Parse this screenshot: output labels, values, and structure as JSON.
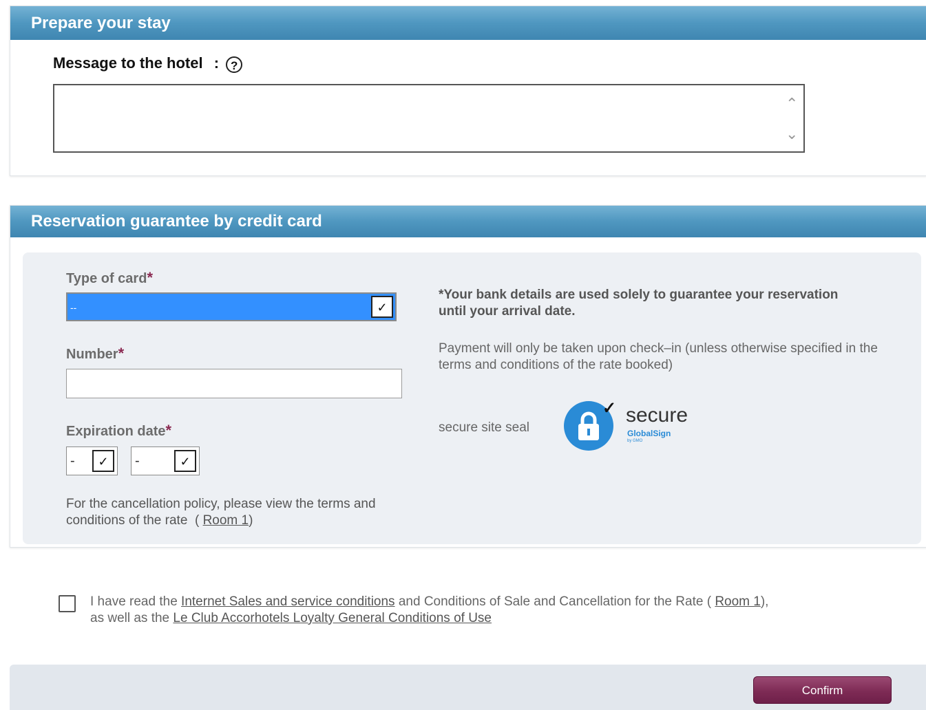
{
  "stay": {
    "title": "Prepare your stay",
    "message_label": "Message to the hotel",
    "message_colon": ":",
    "help_glyph": "?",
    "message_value": ""
  },
  "guarantee": {
    "title": "Reservation guarantee by credit card",
    "card_type_label": "Type of card",
    "card_type_value": "--",
    "number_label": "Number",
    "number_value": "",
    "expiration_label": "Expiration date",
    "exp_month_value": "-",
    "exp_year_value": "-",
    "required_mark": "*",
    "policy_text": "For the cancellation policy, please view the terms and conditions of the rate",
    "policy_open": "(",
    "policy_link": "Room 1",
    "policy_close": ")",
    "bank_bold": "*Your bank details are used solely to guarantee your reservation until your arrival date.",
    "bank_plain": "Payment will only be taken upon check–in (unless otherwise specified in the terms and conditions of the rate booked)",
    "seal_label": "secure site seal",
    "seal_word": "secure",
    "seal_brand": "GlobalSign",
    "seal_sub": "by GMO",
    "seal_icon": "lock-icon"
  },
  "agreement": {
    "t1": "I have read the",
    "link1": "Internet Sales and service conditions",
    "t2": "and Conditions of Sale and Cancellation for the Rate (",
    "link2": "Room 1",
    "t3": "),",
    "t4": "as well as the",
    "link3": "Le Club Accorhotels Loyalty General Conditions of Use",
    "checked": false
  },
  "footer": {
    "confirm_label": "Confirm"
  },
  "colors": {
    "header_blue": "#4f97c0",
    "confirm_purple": "#7e2b55",
    "required_red": "#8b2a52",
    "select_highlight": "#3390ff"
  }
}
